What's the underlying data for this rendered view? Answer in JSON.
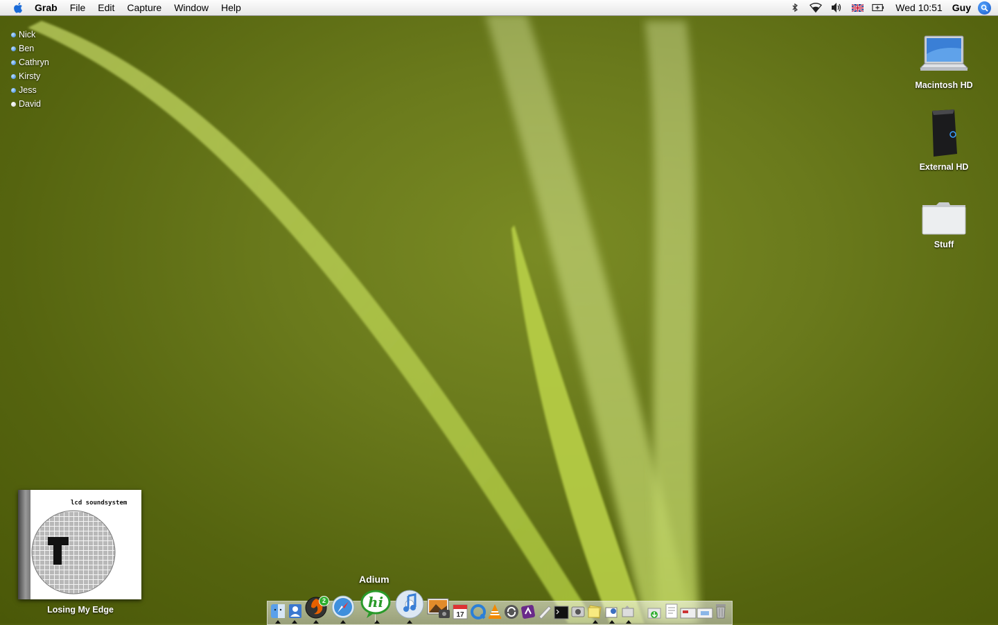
{
  "menubar": {
    "app_name": "Grab",
    "menus": [
      "File",
      "Edit",
      "Capture",
      "Window",
      "Help"
    ],
    "clock": "Wed 10:51",
    "user": "Guy",
    "status_icons": [
      "bluetooth-icon",
      "wifi-icon",
      "volume-icon",
      "uk-flag-icon",
      "battery-icon"
    ]
  },
  "buddies": [
    {
      "name": "Nick",
      "status": "available"
    },
    {
      "name": "Ben",
      "status": "available"
    },
    {
      "name": "Cathryn",
      "status": "available"
    },
    {
      "name": "Kirsty",
      "status": "available"
    },
    {
      "name": "Jess",
      "status": "available"
    },
    {
      "name": "David",
      "status": "idle"
    }
  ],
  "desktop": {
    "icons": [
      {
        "label": "Macintosh HD",
        "icon": "laptop-icon"
      },
      {
        "label": "External HD",
        "icon": "external-drive-icon"
      },
      {
        "label": "Stuff",
        "icon": "folder-icon"
      }
    ]
  },
  "now_playing": {
    "band": "lcd soundsystem",
    "track": "Losing My Edge"
  },
  "dock": {
    "hover_label": "Adium",
    "badge": "2",
    "calendar_day": "17"
  },
  "colors": {
    "accent_blue": "#2f7fe0",
    "wallpaper_green": "#6a7a1c"
  }
}
